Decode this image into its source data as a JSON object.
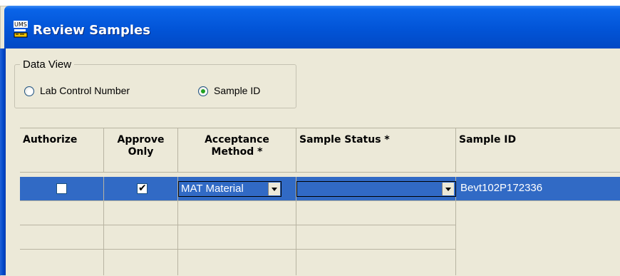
{
  "window": {
    "title": "Review Samples",
    "icon": "ums-app-icon"
  },
  "data_view": {
    "legend": "Data View",
    "options": [
      {
        "label": "Lab Control Number",
        "checked": false
      },
      {
        "label": "Sample ID",
        "checked": true
      }
    ]
  },
  "grid": {
    "columns": [
      {
        "label": "Authorize"
      },
      {
        "label": "Approve Only",
        "line1": "Approve",
        "line2": "Only"
      },
      {
        "label": "Acceptance Method *",
        "line1": "Acceptance",
        "line2": "Method *"
      },
      {
        "label": "Sample Status *"
      },
      {
        "label": "Sample ID"
      }
    ],
    "rows": [
      {
        "selected": true,
        "authorize": false,
        "approve_only": true,
        "acceptance_method": "MAT Material",
        "sample_status": "",
        "sample_id": "Bevt102P172336"
      }
    ],
    "empty_rows": 3
  },
  "colors": {
    "title_bar": "#0254d7",
    "selection": "#316ac5",
    "window_bg": "#ece9d8"
  }
}
